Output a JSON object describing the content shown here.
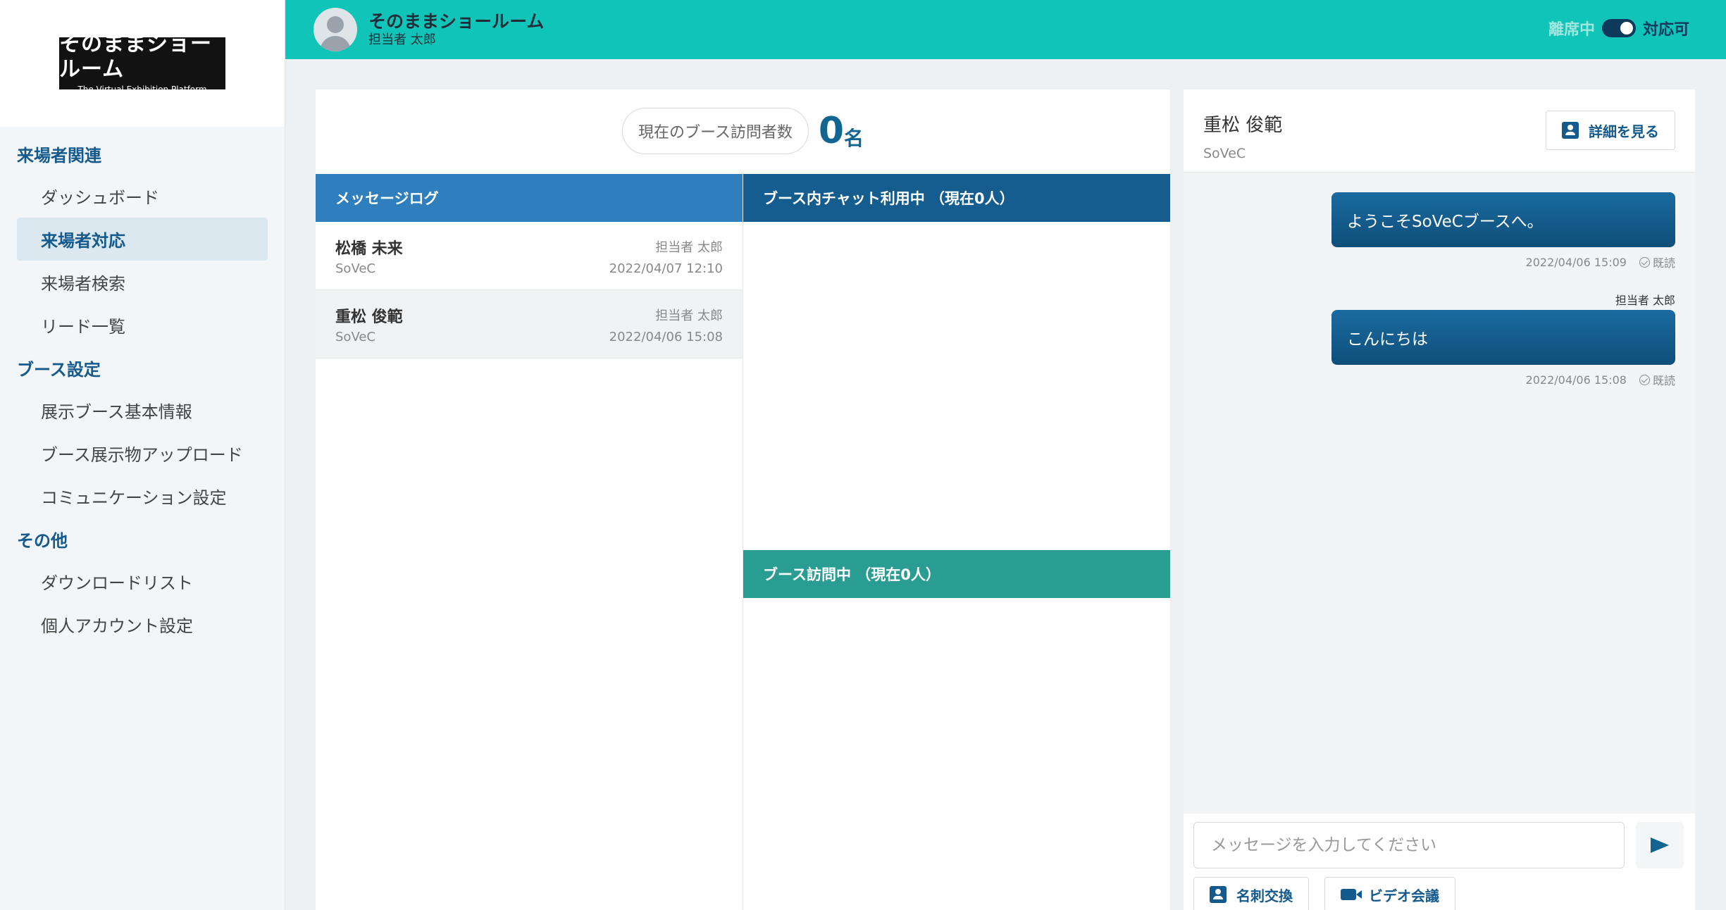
{
  "logo": {
    "main": "そのままショールーム",
    "sub": "The Virtual Exhibition Platform"
  },
  "sidebar": {
    "sections": [
      {
        "title": "来場者関連",
        "items": [
          "ダッシュボード",
          "来場者対応",
          "来場者検索",
          "リード一覧"
        ]
      },
      {
        "title": "ブース設定",
        "items": [
          "展示ブース基本情報",
          "ブース展示物アップロード",
          "コミュニケーション設定"
        ]
      },
      {
        "title": "その他",
        "items": [
          "ダウンロードリスト",
          "個人アカウント設定"
        ]
      }
    ],
    "active_item": "来場者対応"
  },
  "header": {
    "title": "そのままショールーム",
    "subtitle": "担当者 太郎",
    "status_away": "離席中",
    "status_available": "対応可"
  },
  "visitors": {
    "label": "現在のブース訪問者数",
    "count": "0",
    "unit": "名"
  },
  "message_log": {
    "header": "メッセージログ",
    "rows": [
      {
        "name": "松橋 未来",
        "company": "SoVeC",
        "staff": "担当者 太郎",
        "time": "2022/04/07 12:10"
      },
      {
        "name": "重松 俊範",
        "company": "SoVeC",
        "staff": "担当者 太郎",
        "time": "2022/04/06 15:08"
      }
    ]
  },
  "booth_chat": {
    "header": "ブース内チャット利用中 （現在0人）"
  },
  "booth_visit": {
    "header": "ブース訪問中 （現在0人）"
  },
  "conversation": {
    "name": "重松 俊範",
    "company": "SoVeC",
    "detail_label": "詳細を見る",
    "messages": [
      {
        "sender": "",
        "text": "ようこそSoVeCブースへ。",
        "time": "2022/04/06 15:09",
        "status": "既読"
      },
      {
        "sender": "担当者 太郎",
        "text": "こんにちは",
        "time": "2022/04/06 15:08",
        "status": "既読"
      }
    ],
    "input_placeholder": "メッセージを入力してください",
    "card_exchange_label": "名刺交換",
    "video_call_label": "ビデオ会議"
  },
  "colors": {
    "header_bg": "#10c4b8",
    "accent": "#145a8c",
    "message_log_header": "#2f7fbf",
    "booth_chat_header": "#165d8f",
    "booth_visit_header": "#2a9d93"
  }
}
